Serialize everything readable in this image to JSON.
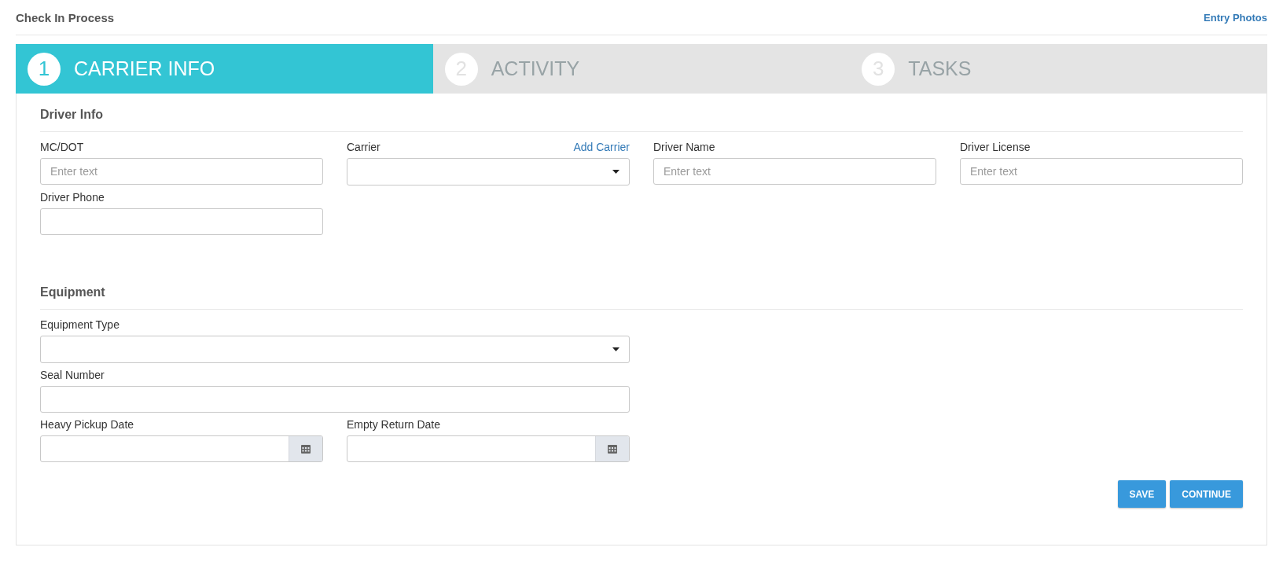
{
  "header": {
    "title": "Check In Process",
    "link": "Entry Photos"
  },
  "steps": [
    {
      "number": "1",
      "label": "CARRIER INFO",
      "selected": true
    },
    {
      "number": "2",
      "label": "ACTIVITY",
      "selected": false
    },
    {
      "number": "3",
      "label": "TASKS",
      "selected": false
    }
  ],
  "driver_info": {
    "title": "Driver Info",
    "fields": [
      {
        "kind": "text",
        "label": "MC/DOT",
        "placeholder": "Enter text"
      },
      {
        "kind": "select",
        "label": "Carrier",
        "link": "Add Carrier"
      },
      {
        "kind": "text",
        "label": "Driver Name",
        "placeholder": "Enter text"
      },
      {
        "kind": "text",
        "label": "Driver License",
        "placeholder": "Enter text"
      },
      {
        "kind": "text",
        "label": "Driver Phone"
      }
    ]
  },
  "equipment": {
    "title": "Equipment",
    "rows": [
      [
        {
          "kind": "select",
          "label": "Equipment Type"
        }
      ],
      [
        {
          "kind": "text",
          "label": "Seal Number"
        }
      ],
      [
        {
          "kind": "date",
          "label": "Heavy Pickup Date"
        },
        {
          "kind": "date",
          "label": "Empty Return Date"
        }
      ]
    ]
  },
  "buttons": [
    "SAVE",
    "CONTINUE"
  ]
}
